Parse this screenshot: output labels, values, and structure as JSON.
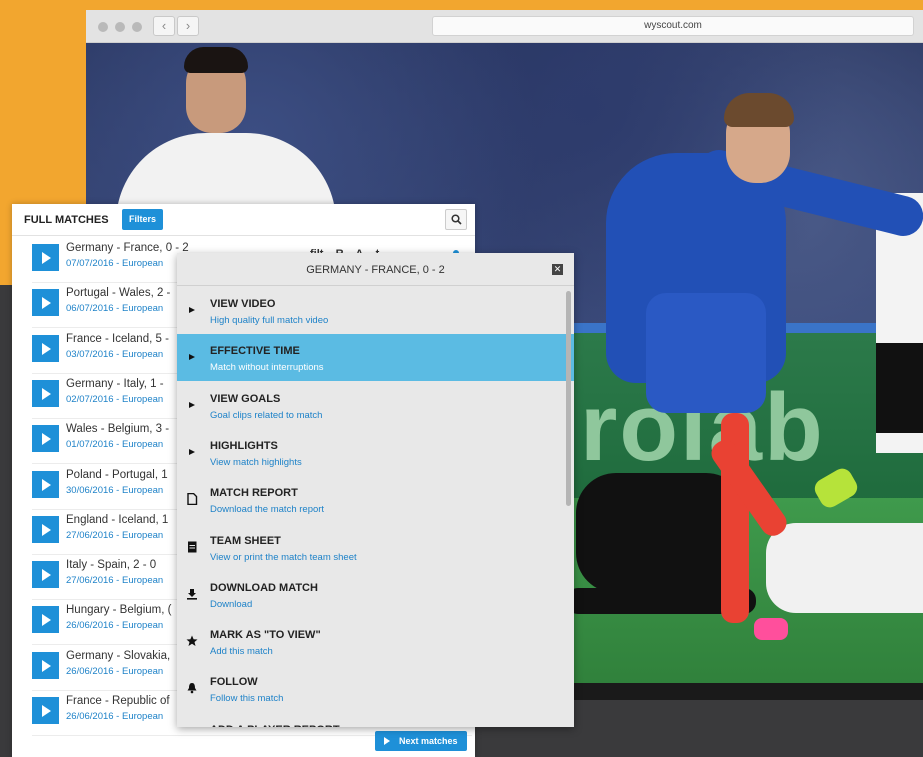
{
  "browser": {
    "url": "wyscout.com"
  },
  "panel": {
    "title": "FULL MATCHES",
    "filters_label": "Filters",
    "stray_text": "filt... R... A... t",
    "next_label": "Next matches",
    "matches": [
      {
        "name": "Germany - France, 0 - 2",
        "date": "07/07/2016 - European"
      },
      {
        "name": "Portugal - Wales, 2 -",
        "date": "06/07/2016 - European"
      },
      {
        "name": "France - Iceland, 5 -",
        "date": "03/07/2016 - European"
      },
      {
        "name": "Germany - Italy, 1 -",
        "date": "02/07/2016 - European"
      },
      {
        "name": "Wales - Belgium, 3 -",
        "date": "01/07/2016 - European"
      },
      {
        "name": "Poland - Portugal, 1",
        "date": "30/06/2016 - European"
      },
      {
        "name": "England - Iceland, 1",
        "date": "27/06/2016 - European"
      },
      {
        "name": "Italy - Spain, 2 - 0",
        "date": "27/06/2016 - European"
      },
      {
        "name": "Hungary - Belgium, (",
        "date": "26/06/2016 - European"
      },
      {
        "name": "Germany - Slovakia,",
        "date": "26/06/2016 - European"
      },
      {
        "name": "France - Republic of",
        "date": "26/06/2016 - European"
      }
    ]
  },
  "popup": {
    "title": "GERMANY - FRANCE, 0 - 2",
    "close_glyph": "✕",
    "items": [
      {
        "label": "VIEW VIDEO",
        "sub": "High quality full match video",
        "icon": "play-icon"
      },
      {
        "label": "EFFECTIVE TIME",
        "sub": "Match without interruptions",
        "icon": "play-icon",
        "active": true
      },
      {
        "label": "VIEW GOALS",
        "sub": "Goal clips related to match",
        "icon": "play-icon"
      },
      {
        "label": "HIGHLIGHTS",
        "sub": "View match highlights",
        "icon": "play-icon"
      },
      {
        "label": "MATCH REPORT",
        "sub": "Download the match report",
        "icon": "document-icon"
      },
      {
        "label": "TEAM SHEET",
        "sub": "View or print the match team sheet",
        "icon": "sheet-icon"
      },
      {
        "label": "DOWNLOAD MATCH",
        "sub": "Download",
        "icon": "download-icon"
      },
      {
        "label": "MARK AS \"TO VIEW\"",
        "sub": "Add this match",
        "icon": "star-icon"
      },
      {
        "label": "FOLLOW",
        "sub": "Follow this match",
        "icon": "bell-icon"
      },
      {
        "label": "ADD A PLAYER REPORT",
        "sub": "",
        "icon": ""
      }
    ]
  },
  "colors": {
    "accent": "#1e90d8",
    "active_item": "#5bbbe3",
    "background": "#f2a62f"
  }
}
